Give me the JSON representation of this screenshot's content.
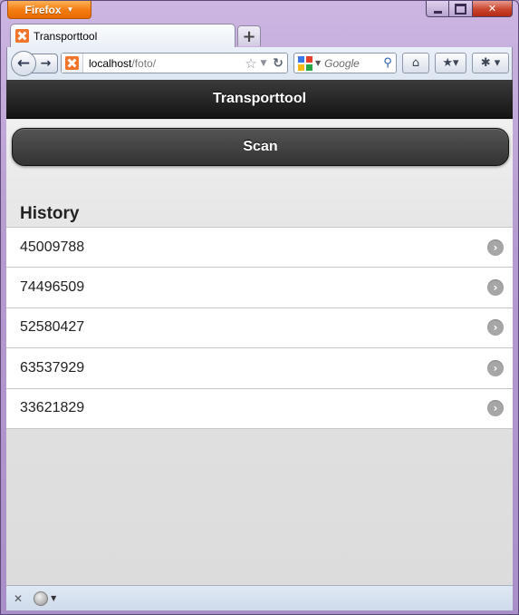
{
  "browser": {
    "menu_label": "Firefox",
    "tab_title": "Transporttool",
    "new_tab_symbol": "+",
    "url_host": "localhost",
    "url_path": "/foto/",
    "search_placeholder": "Google"
  },
  "app": {
    "header_title": "Transporttool",
    "scan_label": "Scan",
    "history_title": "History",
    "history": [
      {
        "id": "45009788"
      },
      {
        "id": "74496509"
      },
      {
        "id": "52580427"
      },
      {
        "id": "63537929"
      },
      {
        "id": "33621829"
      }
    ]
  },
  "icons": {
    "back": "back-arrow-icon",
    "forward": "forward-arrow-icon",
    "home": "home-icon",
    "bookmarks": "bookmarks-icon",
    "search": "search-icon",
    "row_arrow": "chevron-right-icon"
  },
  "colors": {
    "firefox_button": "#f47e14",
    "header_bg": "#1a1a1a",
    "scan_button_bg": "#3a3a3a",
    "window_frame": "#b59bcf"
  }
}
